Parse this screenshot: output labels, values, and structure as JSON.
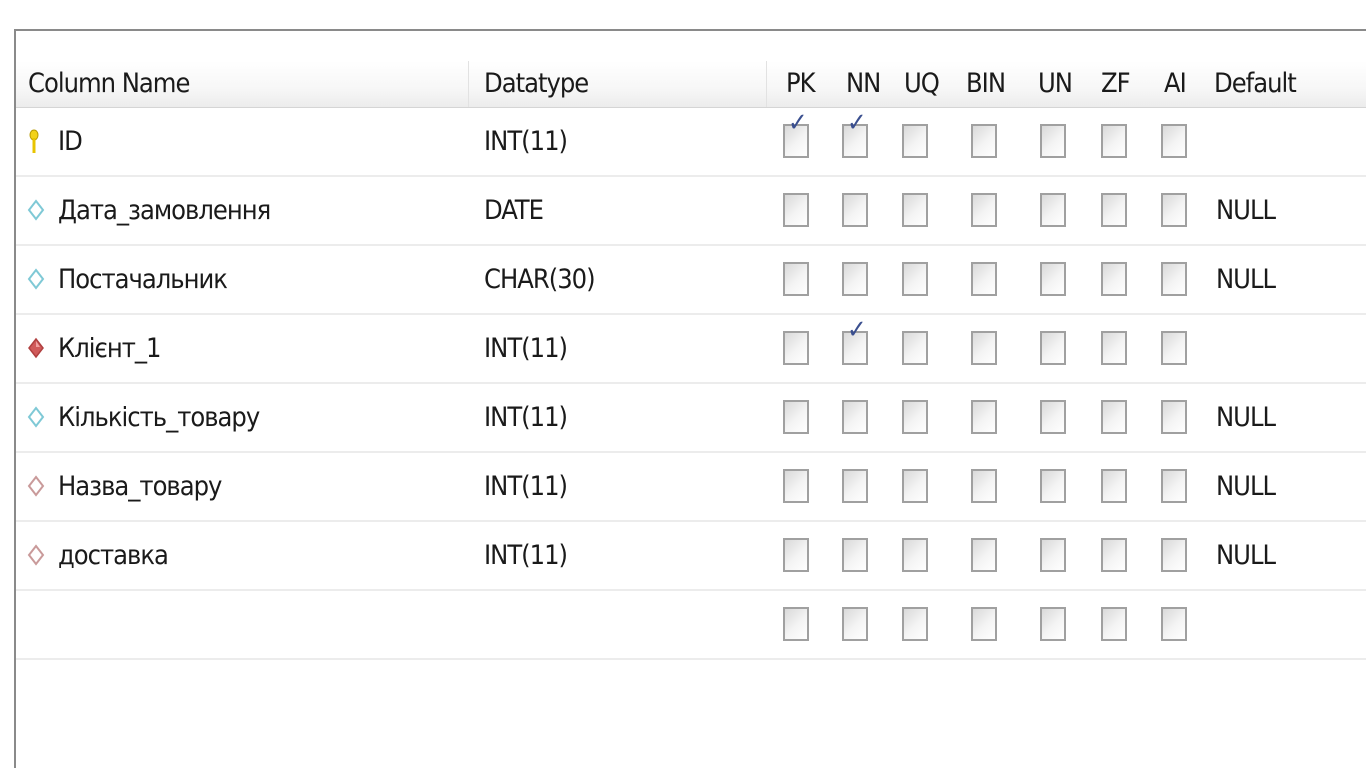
{
  "columns": {
    "name": "Column Name",
    "datatype": "Datatype",
    "pk": "PK",
    "nn": "NN",
    "uq": "UQ",
    "bin": "BIN",
    "un": "UN",
    "zf": "ZF",
    "ai": "AI",
    "default": "Default"
  },
  "rows": [
    {
      "icon": "primary-key-icon",
      "name": "ID",
      "datatype": "INT(11)",
      "pk": true,
      "nn": true,
      "uq": false,
      "bin": false,
      "un": false,
      "zf": false,
      "ai": false,
      "default": ""
    },
    {
      "icon": "column-icon",
      "name": "Дата_замовлення",
      "datatype": "DATE",
      "pk": false,
      "nn": false,
      "uq": false,
      "bin": false,
      "un": false,
      "zf": false,
      "ai": false,
      "default": "NULL"
    },
    {
      "icon": "column-icon",
      "name": "Постачальник",
      "datatype": "CHAR(30)",
      "pk": false,
      "nn": false,
      "uq": false,
      "bin": false,
      "un": false,
      "zf": false,
      "ai": false,
      "default": "NULL"
    },
    {
      "icon": "foreign-key-not-null-icon",
      "name": "Клієнт_1",
      "datatype": "INT(11)",
      "pk": false,
      "nn": true,
      "uq": false,
      "bin": false,
      "un": false,
      "zf": false,
      "ai": false,
      "default": ""
    },
    {
      "icon": "column-icon",
      "name": "Кількість_товару",
      "datatype": "INT(11)",
      "pk": false,
      "nn": false,
      "uq": false,
      "bin": false,
      "un": false,
      "zf": false,
      "ai": false,
      "default": "NULL"
    },
    {
      "icon": "foreign-key-icon",
      "name": "Назва_товару",
      "datatype": "INT(11)",
      "pk": false,
      "nn": false,
      "uq": false,
      "bin": false,
      "un": false,
      "zf": false,
      "ai": false,
      "default": "NULL"
    },
    {
      "icon": "foreign-key-icon",
      "name": "доставка",
      "datatype": "INT(11)",
      "pk": false,
      "nn": false,
      "uq": false,
      "bin": false,
      "un": false,
      "zf": false,
      "ai": false,
      "default": "NULL"
    },
    {
      "icon": "",
      "name": "",
      "datatype": "",
      "pk": false,
      "nn": false,
      "uq": false,
      "bin": false,
      "un": false,
      "zf": false,
      "ai": false,
      "default": ""
    }
  ],
  "colors": {
    "key_yellow": "#e8c400",
    "column_cyan": "#7fc9d6",
    "fk_red": "#d05a5a",
    "fk_pink": "#c99a9a",
    "check_blue": "#3a4f8f"
  }
}
